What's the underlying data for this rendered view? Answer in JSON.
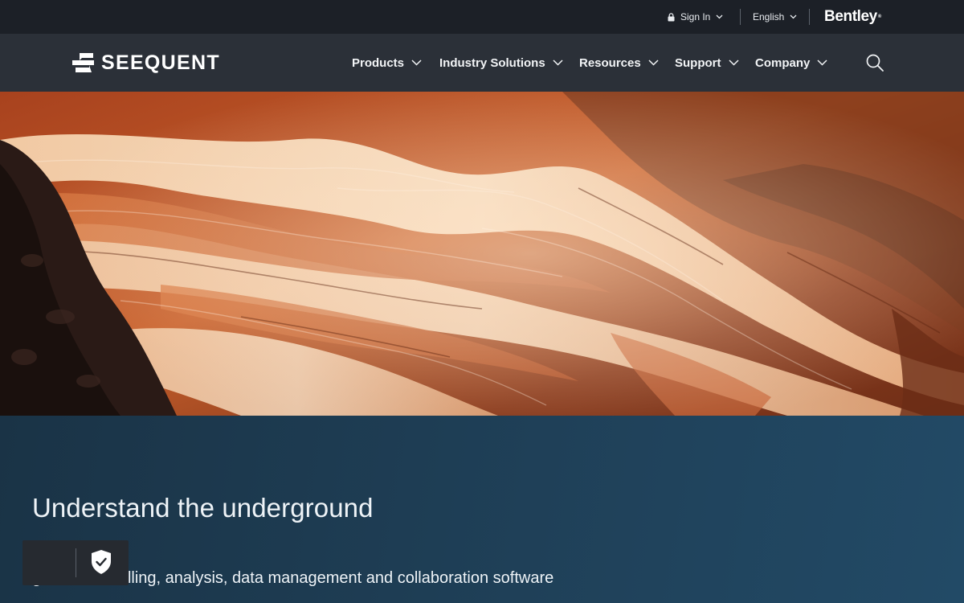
{
  "utility": {
    "sign_in": "Sign In",
    "language": "English",
    "partner_logo": "Bentley"
  },
  "nav": {
    "brand": "SEEQUENT",
    "items": [
      {
        "label": "Products"
      },
      {
        "label": "Industry Solutions"
      },
      {
        "label": "Resources"
      },
      {
        "label": "Support"
      },
      {
        "label": "Company"
      }
    ],
    "search_icon": "search-icon"
  },
  "hero": {
    "image": "canyon-rock-formation"
  },
  "content": {
    "headline": "Understand the underground",
    "subline": "g earth-modelling, analysis, data management and collaboration software"
  },
  "privacy_widget": {
    "icon": "shield-check-icon"
  },
  "colors": {
    "utility_bar": "#1c2027",
    "nav_bar": "#2b3038",
    "content_band": "#1f4058"
  }
}
